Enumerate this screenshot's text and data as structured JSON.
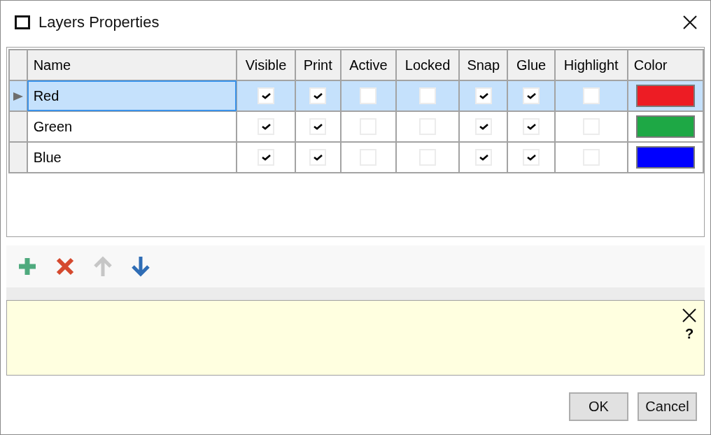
{
  "window": {
    "title": "Layers Properties"
  },
  "table": {
    "columns": [
      "Name",
      "Visible",
      "Print",
      "Active",
      "Locked",
      "Snap",
      "Glue",
      "Highlight",
      "Color"
    ],
    "rows": [
      {
        "name": "Red",
        "selected": true,
        "checks": [
          {
            "checked": true
          },
          {
            "checked": true
          },
          {
            "checked": false
          },
          {
            "checked": false
          },
          {
            "checked": true
          },
          {
            "checked": true
          },
          {
            "checked": false
          }
        ],
        "color": "#ed1c24"
      },
      {
        "name": "Green",
        "selected": false,
        "checks": [
          {
            "checked": true
          },
          {
            "checked": true
          },
          {
            "checked": false
          },
          {
            "checked": false
          },
          {
            "checked": true
          },
          {
            "checked": true
          },
          {
            "checked": false
          }
        ],
        "color": "#1ea845"
      },
      {
        "name": "Blue",
        "selected": false,
        "checks": [
          {
            "checked": true
          },
          {
            "checked": true
          },
          {
            "checked": false
          },
          {
            "checked": false
          },
          {
            "checked": true
          },
          {
            "checked": true
          },
          {
            "checked": false
          }
        ],
        "color": "#0000ff"
      }
    ]
  },
  "toolbar": [
    {
      "kind": "add",
      "disabled": false
    },
    {
      "kind": "delete",
      "disabled": false
    },
    {
      "kind": "up",
      "disabled": true
    },
    {
      "kind": "down",
      "disabled": false
    }
  ],
  "info_panel": {
    "help": "?"
  },
  "buttons": [
    "OK",
    "Cancel"
  ]
}
